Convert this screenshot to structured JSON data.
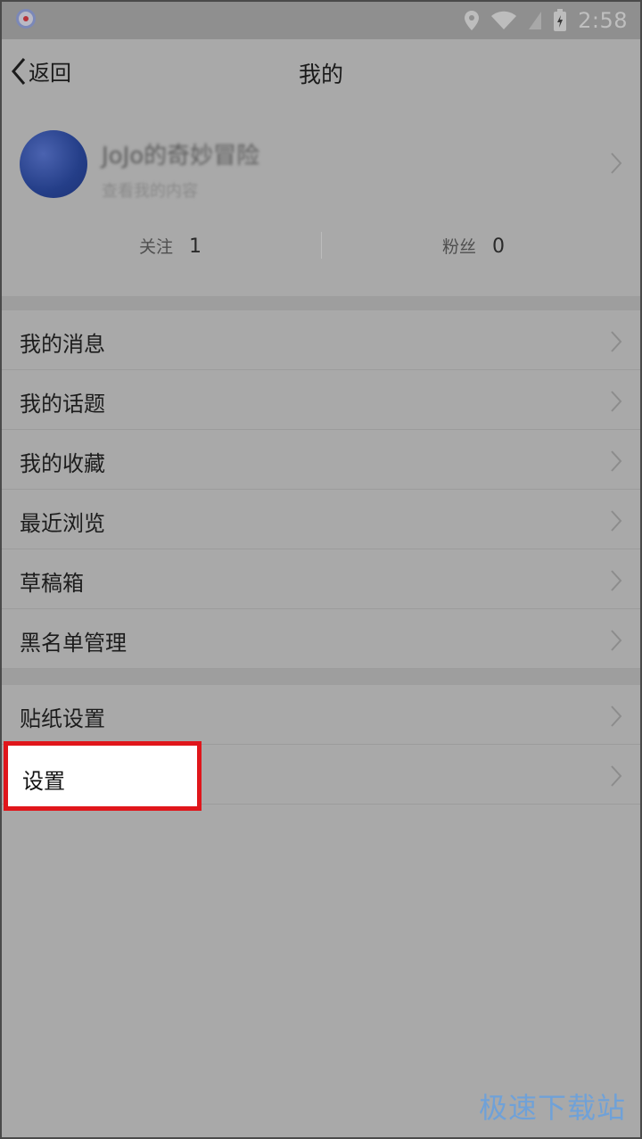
{
  "status_bar": {
    "time": "2:58",
    "icons": [
      "record-icon",
      "location-icon",
      "wifi-icon",
      "signal-icon",
      "battery-icon"
    ]
  },
  "header": {
    "back_label": "返回",
    "title": "我的"
  },
  "profile": {
    "username": "JoJo的奇妙冒险",
    "subtitle": "查看我的内容"
  },
  "stats": {
    "following_label": "关注",
    "following_value": "1",
    "followers_label": "粉丝",
    "followers_value": "0"
  },
  "menu_group_1": [
    {
      "label": "我的消息"
    },
    {
      "label": "我的话题"
    },
    {
      "label": "我的收藏"
    },
    {
      "label": "最近浏览"
    },
    {
      "label": "草稿箱"
    },
    {
      "label": "黑名单管理"
    }
  ],
  "menu_group_2": [
    {
      "label": "贴纸设置"
    },
    {
      "label": "设置"
    }
  ],
  "watermark": "极速下载站",
  "colors": {
    "highlight_border": "#e0161b",
    "overlay_gray": "#a9a9a9",
    "watermark_blue": "#6fa1d8"
  }
}
